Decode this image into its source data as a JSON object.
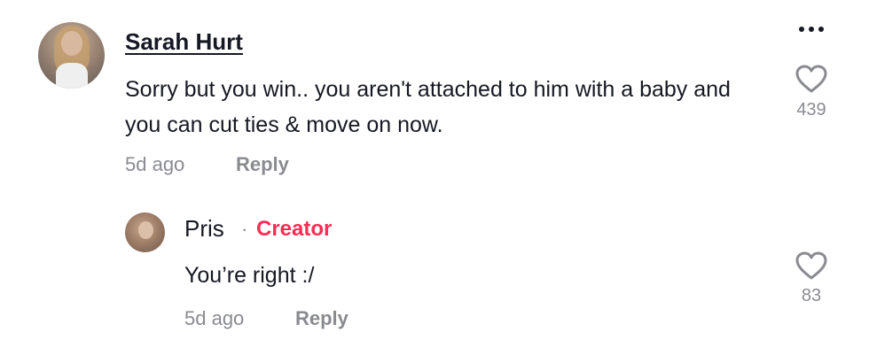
{
  "comment": {
    "username": "Sarah Hurt",
    "text": "Sorry but you win.. you aren't attached to him with a baby and you can cut ties & move on now.",
    "time": "5d ago",
    "reply_label": "Reply",
    "like_count": "439",
    "more_icon": "more-horizontal-icon",
    "like_icon": "heart-outline-icon"
  },
  "reply": {
    "username": "Pris",
    "separator": "·",
    "badge": "Creator",
    "badge_color": "#fe2c55",
    "text": "You’re right :/",
    "time": "5d ago",
    "reply_label": "Reply",
    "like_count": "83",
    "like_icon": "heart-outline-icon"
  },
  "colors": {
    "primary_text": "#161823",
    "secondary_text": "#8a8b91",
    "accent": "#fe2c55",
    "background": "#ffffff"
  }
}
